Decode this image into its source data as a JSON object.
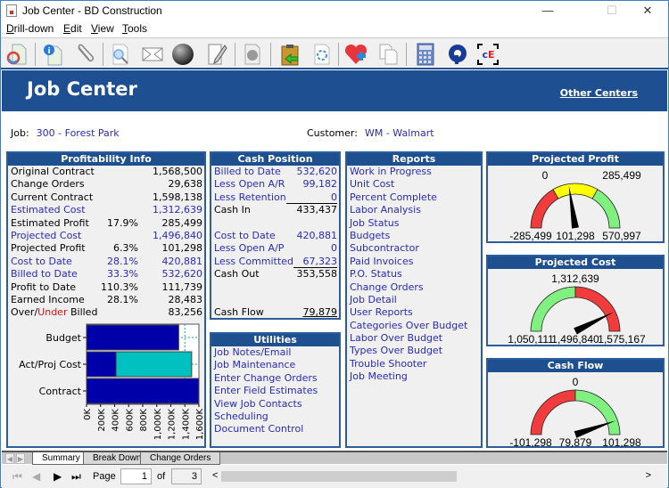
{
  "window": {
    "title": "Job Center - BD Construction",
    "controls": {
      "minimize": "—",
      "maximize": "☐",
      "close": "✕"
    }
  },
  "menu": [
    {
      "label": "Drill-down",
      "accel": "D",
      "rest": "rill-down"
    },
    {
      "label": "Edit",
      "accel": "E",
      "rest": "dit"
    },
    {
      "label": "View",
      "accel": "V",
      "rest": "iew"
    },
    {
      "label": "Tools",
      "accel": "T",
      "rest": "ools"
    }
  ],
  "toolbar": {
    "icons": [
      "refresh-document-icon",
      "info-document-icon",
      "paperclip-icon",
      "search-document-icon",
      "envelope-icon",
      "sphere-icon",
      "edit-document-icon",
      "blank-document-icon",
      "clipboard-import-icon",
      "settings-document-icon",
      "health-add-icon",
      "copy-icon",
      "calculator-icon",
      "q-logo-icon",
      "ce-logo-icon"
    ]
  },
  "banner": {
    "title": "Job Center",
    "other_centers": "Other Centers"
  },
  "job": {
    "label": "Job:",
    "value": "300 - Forest Park"
  },
  "customer": {
    "label": "Customer:",
    "value": "WM - Walmart"
  },
  "profitability": {
    "title": "Profitability Info",
    "rows": [
      {
        "label": "Original Contract",
        "pct": "",
        "amount": "1,568,500",
        "link": false
      },
      {
        "label": "Change Orders",
        "pct": "",
        "amount": "29,638",
        "link": false
      },
      {
        "label": "Current Contract",
        "pct": "",
        "amount": "1,598,138",
        "link": false
      },
      {
        "label": "Estimated Cost",
        "pct": "",
        "amount": "1,312,639",
        "link": true
      },
      {
        "label": "Estimated Profit",
        "pct": "17.9%",
        "amount": "285,499",
        "link": false
      },
      {
        "label": "Projected Cost",
        "pct": "",
        "amount": "1,496,840",
        "link": true
      },
      {
        "label": "Projected Profit",
        "pct": "6.3%",
        "amount": "101,298",
        "link": false
      },
      {
        "label": "Cost to Date",
        "pct": "28.1%",
        "amount": "420,881",
        "link": true
      },
      {
        "label": "Billed to Date",
        "pct": "33.3%",
        "amount": "532,620",
        "link": true
      },
      {
        "label": "Profit to Date",
        "pct": "110.3%",
        "amount": "111,739",
        "link": false
      },
      {
        "label": "Earned Income",
        "pct": "28.1%",
        "amount": "28,483",
        "link": false
      }
    ],
    "over_under": {
      "over": "Over/",
      "under": "Under",
      "billed": " Billed",
      "amount": "83,256"
    }
  },
  "chart_data": {
    "type": "bar",
    "orientation": "horizontal",
    "categories": [
      "Budget",
      "Act/Proj Cost",
      "Contract"
    ],
    "series": [
      {
        "name": "Budget",
        "color": "#0000a8",
        "values": [
          1312639,
          null,
          null
        ]
      },
      {
        "name": "Actual Cost",
        "color": "#0000a8",
        "values": [
          null,
          420881,
          null
        ]
      },
      {
        "name": "Projected Cost",
        "color": "#00c0c0",
        "values": [
          null,
          1496840,
          null
        ]
      },
      {
        "name": "Contract",
        "color": "#0000a8",
        "values": [
          null,
          null,
          1598138
        ]
      }
    ],
    "xlim": [
      0,
      1600000
    ],
    "x_ticks": [
      "0K",
      "200K",
      "400K",
      "600K",
      "800K",
      "1,000K",
      "1,200K",
      "1,400K",
      "1,600K"
    ],
    "reference_line": {
      "value": 1400000,
      "style": "dashed"
    },
    "title": "",
    "xlabel": "",
    "ylabel": ""
  },
  "cash_position": {
    "title": "Cash Position",
    "rows": [
      {
        "label": "Billed to Date",
        "amount": "532,620",
        "link": true
      },
      {
        "label": "Less Open A/R",
        "amount": "99,182",
        "link": true
      },
      {
        "label": "Less Retention",
        "amount": "0",
        "link": true,
        "underline": true
      },
      {
        "label": "Cash In",
        "amount": "433,437",
        "link": false
      },
      {
        "label": "",
        "amount": "",
        "link": false
      },
      {
        "label": "Cost to Date",
        "amount": "420,881",
        "link": true
      },
      {
        "label": "Less Open A/P",
        "amount": "0",
        "link": true
      },
      {
        "label": "Less Committed",
        "amount": "67,323",
        "link": true,
        "underline": true
      },
      {
        "label": "Cash Out",
        "amount": "353,558",
        "link": false
      },
      {
        "label": "",
        "amount": "",
        "link": false
      },
      {
        "label": "",
        "amount": "",
        "link": false
      },
      {
        "label": "Cash Flow",
        "amount": "79,879",
        "link": false,
        "underline": true
      }
    ]
  },
  "utilities": {
    "title": "Utilities",
    "items": [
      "Job Notes/Email",
      "Job Maintenance",
      "Enter Change Orders",
      "Enter Field Estimates",
      "View Job Contacts",
      "Scheduling",
      "Document Control"
    ]
  },
  "reports": {
    "title": "Reports",
    "items": [
      "Work in Progress",
      "Unit Cost",
      "Percent Complete",
      "Labor Analysis",
      "Job Status",
      "Budgets",
      "Subcontractor",
      "Paid Invoices",
      "P.O. Status",
      "Change Orders",
      "Job Detail",
      "User Reports",
      "Categories Over Budget",
      "Labor Over Budget",
      "Types Over Budget",
      "Trouble Shooter",
      "Job Meeting"
    ]
  },
  "gauges": [
    {
      "title": "Projected Profit",
      "min": -285499,
      "max": 570997,
      "value": 101298,
      "labels": {
        "min": "-285,499",
        "value": "101,298",
        "max": "570,997",
        "mark1": "0",
        "mark2": "285,499"
      },
      "bands": [
        {
          "from": -285499,
          "to": 0,
          "color": "#f03c3c"
        },
        {
          "from": 0,
          "to": 285499,
          "color": "#ffff00"
        },
        {
          "from": 285499,
          "to": 570997,
          "color": "#80f080"
        }
      ]
    },
    {
      "title": "Projected Cost",
      "min": 1050111,
      "max": 1575167,
      "value": 1496840,
      "labels": {
        "min": "1,050,111",
        "value": "1,496,840",
        "max": "1,575,167",
        "mark1": "1,312,639"
      },
      "bands": [
        {
          "from": 1050111,
          "to": 1312639,
          "color": "#80f080"
        },
        {
          "from": 1312639,
          "to": 1575167,
          "color": "#f03c3c"
        }
      ]
    },
    {
      "title": "Cash Flow",
      "min": -101298,
      "max": 101298,
      "value": 79879,
      "labels": {
        "min": "-101,298",
        "value": "79,879",
        "max": "101,298",
        "mark1": "0"
      },
      "bands": [
        {
          "from": -101298,
          "to": 0,
          "color": "#f03c3c"
        },
        {
          "from": 0,
          "to": 101298,
          "color": "#80f080"
        }
      ]
    }
  ],
  "sheet_tabs": [
    {
      "label": "Summary",
      "active": true
    },
    {
      "label": "Break Down",
      "active": false
    },
    {
      "label": "Change Orders",
      "active": false
    }
  ],
  "pager": {
    "page_label": "Page",
    "page": "1",
    "of_label": "of",
    "total": "3",
    "scroll_left": "<",
    "scroll_right": ">"
  }
}
